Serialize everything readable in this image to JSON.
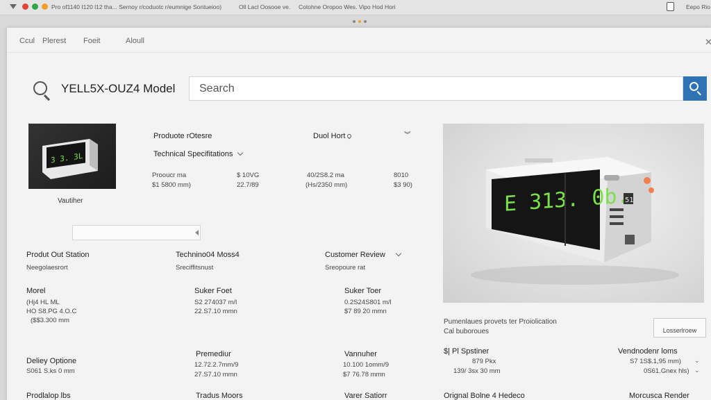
{
  "topbar": {
    "left_text": "Pro of1140 I120 l12 tha... Sernoy r/coduotc r/eumnige Sontueioo)",
    "mid_text": "Oll Lacl Oosooe ve.",
    "right_text": "Cotohne Oropoo Wes. Vipo Hod Hori",
    "far_right_text": "Eepo Rio"
  },
  "nav": {
    "items": [
      "Ccul",
      "Plerest",
      "Foeit",
      "Aloull"
    ]
  },
  "header": {
    "title": "YELL5X-OUZ4 Model",
    "search_placeholder": "Search"
  },
  "product": {
    "thumb_display": "3 3. 3L",
    "caption": "Vautiher",
    "section_title": "Produote rOtesre",
    "dual_label": "Duol Hort",
    "tech_specs": "Technical Specifitations",
    "specs": [
      {
        "label": "Prooucr ma",
        "value": "$1 5800 mm)"
      },
      {
        "label": "$ 10VG",
        "value": "22.7/89"
      },
      {
        "label": "40/2S8.2 ma",
        "value": "(Hs/2350 mm)"
      },
      {
        "label": "8010",
        "value": "$3 90)"
      }
    ]
  },
  "hero": {
    "display": "E 313. 0b.",
    "badge": "51"
  },
  "sections": {
    "col1_title": "Produt Out Station",
    "col1_sub": "Neegolaesrort",
    "col2_title": "Technino04 Moss4",
    "col2_sub": "Sreciffitsnust",
    "col3_title": "Customer Review",
    "col3_sub": "Sreopoure rat",
    "model_label": "Morel",
    "model_lines": [
      "(Hj4 HL ML",
      "HO S8.PG 4.O.C",
      "($$3.300 mm"
    ],
    "suker1_label": "Suker Foet",
    "suker1_lines": [
      "S2 274037 m/l",
      "22.S7.10 mmn"
    ],
    "suker2_label": "Suker Toer",
    "suker2_lines": [
      "0.2S24S801 m/l",
      "$7 89 20 mmn"
    ]
  },
  "promo": {
    "line1": "Pumenlaues provets ter Proiolication",
    "line2": "Cal buboroues",
    "button": "Losserlroew"
  },
  "bottom": {
    "delivery_title": "Deliey Optione",
    "delivery_sub": "S061 S.ks 0 mm",
    "prem_title": "Premediur",
    "prem_lines": [
      "12.72.2.7mm/9",
      "27.S7.10 mmn"
    ],
    "vann_title": "Vannuher",
    "vann_lines": [
      "10.100 1omm/9",
      "$7 76.78 mmn"
    ],
    "spt_title": "$| Pl  Spstiner",
    "spt_lines": [
      "879 Pkx",
      "139/ 3sx 30 mm"
    ],
    "vend_title": "Vendnodenr loms",
    "vend_lines": [
      "S7 1S$.1,95 mm)",
      "0S61.Gnex hls)"
    ],
    "row2": [
      "Prodlalop lbs",
      "Tradus Moors",
      "Varer Satiorr",
      "Orignal Bolne 4 Hedeco",
      "Morcusca Render"
    ]
  },
  "colors": {
    "accent": "#2f73b5",
    "lcd": "#7be04a",
    "dot_red": "#e0453a",
    "dot_green": "#2ea84a",
    "dot_orange": "#f0a02a"
  }
}
